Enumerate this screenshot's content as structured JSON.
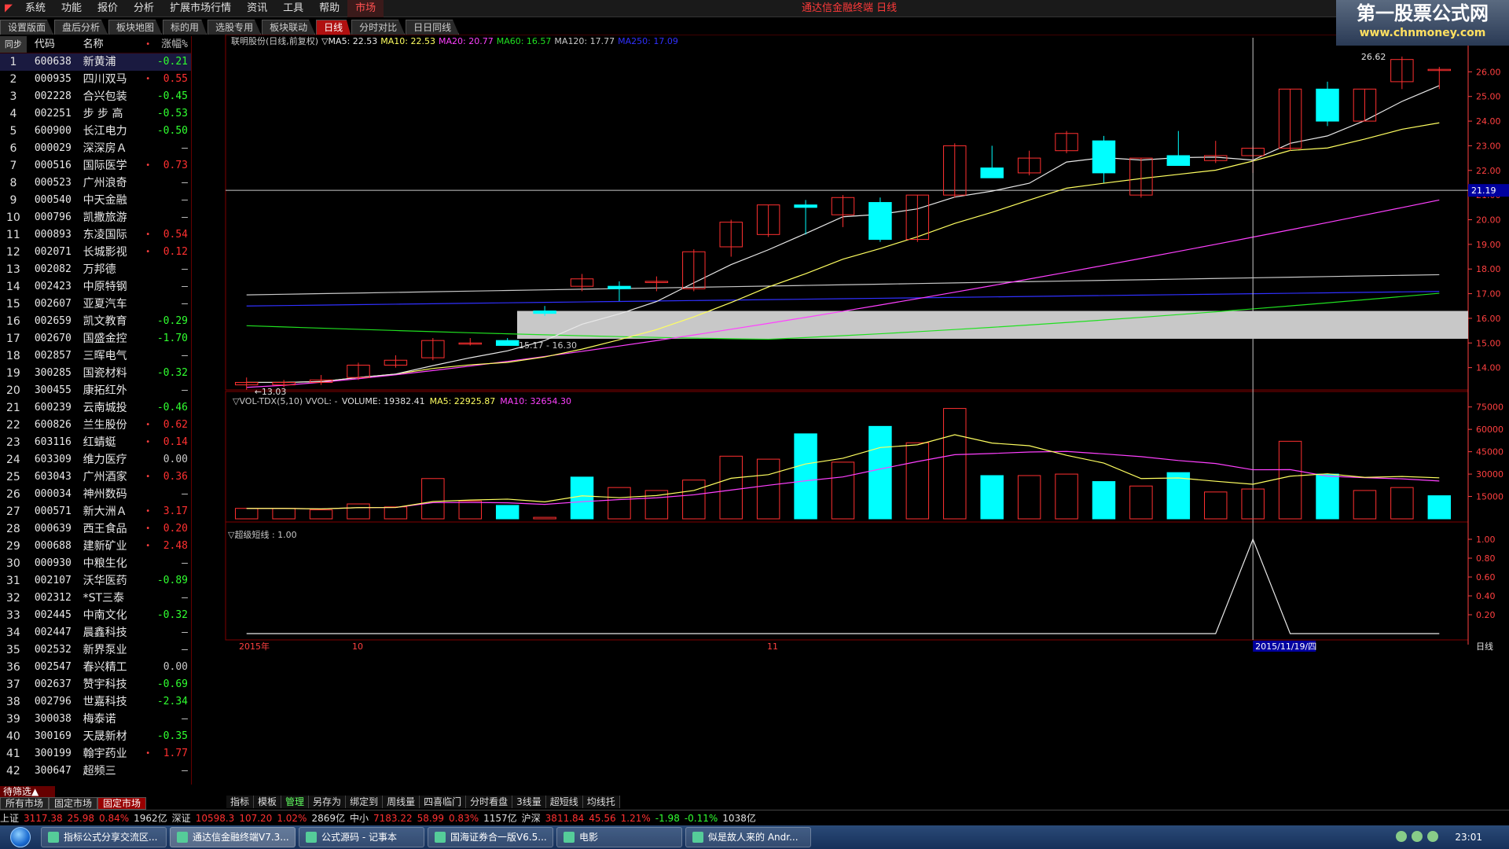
{
  "menubar": {
    "items": [
      "系统",
      "功能",
      "报价",
      "分析",
      "扩展市场行情",
      "资讯",
      "工具",
      "帮助",
      "市场"
    ],
    "title": "通达信金融终端 日线",
    "brand_main": "第一股票公式网",
    "brand_url": "www.chnmoney.com"
  },
  "tabs": [
    "设置版面",
    "盘后分析",
    "板块地图",
    "标的用",
    "选股专用",
    "板块联动",
    "日线",
    "分时对比",
    "日日同线"
  ],
  "active_tab": 6,
  "list": {
    "head": {
      "sync": "同步",
      "code": "代码",
      "name": "名称",
      "dot": "•",
      "chg": "涨幅%"
    },
    "rows": [
      {
        "i": "1",
        "code": "600638",
        "name": "新黄浦",
        "mark": "",
        "chg": "-0.21",
        "dir": "down"
      },
      {
        "i": "2",
        "code": "000935",
        "name": "四川双马",
        "mark": "•",
        "chg": "0.55",
        "dir": "up"
      },
      {
        "i": "3",
        "code": "002228",
        "name": "合兴包装",
        "mark": "",
        "chg": "-0.45",
        "dir": "down"
      },
      {
        "i": "4",
        "code": "002251",
        "name": "步 步 高",
        "mark": "",
        "chg": "-0.53",
        "dir": "down"
      },
      {
        "i": "5",
        "code": "600900",
        "name": "长江电力",
        "mark": "",
        "chg": "-0.50",
        "dir": "down"
      },
      {
        "i": "6",
        "code": "000029",
        "name": "深深房Ａ",
        "mark": "",
        "chg": "–",
        "dir": "flat"
      },
      {
        "i": "7",
        "code": "000516",
        "name": "国际医学",
        "mark": "•",
        "chg": "0.73",
        "dir": "up"
      },
      {
        "i": "8",
        "code": "000523",
        "name": "广州浪奇",
        "mark": "",
        "chg": "–",
        "dir": "flat"
      },
      {
        "i": "9",
        "code": "000540",
        "name": "中天金融",
        "mark": "",
        "chg": "–",
        "dir": "flat"
      },
      {
        "i": "10",
        "code": "000796",
        "name": "凯撒旅游",
        "mark": "",
        "chg": "–",
        "dir": "flat"
      },
      {
        "i": "11",
        "code": "000893",
        "name": "东凌国际",
        "mark": "•",
        "chg": "0.54",
        "dir": "up"
      },
      {
        "i": "12",
        "code": "002071",
        "name": "长城影视",
        "mark": "•",
        "chg": "0.12",
        "dir": "up"
      },
      {
        "i": "13",
        "code": "002082",
        "name": "万邦德",
        "mark": "",
        "chg": "–",
        "dir": "flat"
      },
      {
        "i": "14",
        "code": "002423",
        "name": "中原特钢",
        "mark": "",
        "chg": "–",
        "dir": "flat"
      },
      {
        "i": "15",
        "code": "002607",
        "name": "亚夏汽车",
        "mark": "",
        "chg": "–",
        "dir": "flat"
      },
      {
        "i": "16",
        "code": "002659",
        "name": "凯文教育",
        "mark": "",
        "chg": "-0.29",
        "dir": "down"
      },
      {
        "i": "17",
        "code": "002670",
        "name": "国盛金控",
        "mark": "",
        "chg": "-1.70",
        "dir": "down"
      },
      {
        "i": "18",
        "code": "002857",
        "name": "三晖电气",
        "mark": "",
        "chg": "–",
        "dir": "flat"
      },
      {
        "i": "19",
        "code": "300285",
        "name": "国瓷材料",
        "mark": "",
        "chg": "-0.32",
        "dir": "down"
      },
      {
        "i": "20",
        "code": "300455",
        "name": "康拓红外",
        "mark": "",
        "chg": "–",
        "dir": "flat"
      },
      {
        "i": "21",
        "code": "600239",
        "name": "云南城投",
        "mark": "",
        "chg": "-0.46",
        "dir": "down"
      },
      {
        "i": "22",
        "code": "600826",
        "name": "兰生股份",
        "mark": "•",
        "chg": "0.62",
        "dir": "up"
      },
      {
        "i": "23",
        "code": "603116",
        "name": "红蜻蜓",
        "mark": "•",
        "chg": "0.14",
        "dir": "up"
      },
      {
        "i": "24",
        "code": "603309",
        "name": "维力医疗",
        "mark": "",
        "chg": "0.00",
        "dir": "flat"
      },
      {
        "i": "25",
        "code": "603043",
        "name": "广州酒家",
        "mark": "•",
        "chg": "0.36",
        "dir": "up"
      },
      {
        "i": "26",
        "code": "000034",
        "name": "神州数码",
        "mark": "",
        "chg": "–",
        "dir": "flat"
      },
      {
        "i": "27",
        "code": "000571",
        "name": "新大洲Ａ",
        "mark": "•",
        "chg": "3.17",
        "dir": "up"
      },
      {
        "i": "28",
        "code": "000639",
        "name": "西王食品",
        "mark": "•",
        "chg": "0.20",
        "dir": "up"
      },
      {
        "i": "29",
        "code": "000688",
        "name": "建新矿业",
        "mark": "•",
        "chg": "2.48",
        "dir": "up"
      },
      {
        "i": "30",
        "code": "000930",
        "name": "中粮生化",
        "mark": "",
        "chg": "–",
        "dir": "flat"
      },
      {
        "i": "31",
        "code": "002107",
        "name": "沃华医药",
        "mark": "",
        "chg": "-0.89",
        "dir": "down"
      },
      {
        "i": "32",
        "code": "002312",
        "name": "*ST三泰",
        "mark": "",
        "chg": "–",
        "dir": "flat"
      },
      {
        "i": "33",
        "code": "002445",
        "name": "中南文化",
        "mark": "",
        "chg": "-0.32",
        "dir": "down"
      },
      {
        "i": "34",
        "code": "002447",
        "name": "晨鑫科技",
        "mark": "",
        "chg": "–",
        "dir": "flat"
      },
      {
        "i": "35",
        "code": "002532",
        "name": "新界泵业",
        "mark": "",
        "chg": "–",
        "dir": "flat"
      },
      {
        "i": "36",
        "code": "002547",
        "name": "春兴精工",
        "mark": "",
        "chg": "0.00",
        "dir": "flat"
      },
      {
        "i": "37",
        "code": "002637",
        "name": "赞宇科技",
        "mark": "",
        "chg": "-0.69",
        "dir": "down"
      },
      {
        "i": "38",
        "code": "002796",
        "name": "世嘉科技",
        "mark": "",
        "chg": "-2.34",
        "dir": "down"
      },
      {
        "i": "39",
        "code": "300038",
        "name": "梅泰诺",
        "mark": "",
        "chg": "–",
        "dir": "flat"
      },
      {
        "i": "40",
        "code": "300169",
        "name": "天晟新材",
        "mark": "",
        "chg": "-0.35",
        "dir": "down"
      },
      {
        "i": "41",
        "code": "300199",
        "name": "翰宇药业",
        "mark": "•",
        "chg": "1.77",
        "dir": "up"
      },
      {
        "i": "42",
        "code": "300647",
        "name": "超频三",
        "mark": "",
        "chg": "–",
        "dir": "flat"
      }
    ]
  },
  "list_tabs": {
    "filter": "待筛选▲",
    "tabs": [
      "所有市场",
      "固定市场",
      "固定市场"
    ],
    "active": 2
  },
  "indicator_tabs": [
    "指标",
    "模板",
    "管理",
    "另存为",
    "绑定到",
    "周线量",
    "四喜临门",
    "分时看盘",
    "3线量",
    "超短线",
    "均线托"
  ],
  "indicator_active": 2,
  "colors": {
    "up": "#ff3030",
    "down": "#30ff30",
    "bear_fill": "#00ffff",
    "ma5": "#e8e8e8",
    "ma10": "#ffff60",
    "ma20": "#ff40ff",
    "ma60": "#20e020",
    "ma120": "#c8c8c8",
    "ma250": "#3030ff",
    "grid": "#800000",
    "axis": "#ff4040"
  },
  "panels": {
    "price_header": "联明股份(日线,前复权)",
    "ma5": "▽MA5: 22.53",
    "ma10": "MA10: 22.53",
    "ma20": "MA20: 20.77",
    "ma60": "MA60: 16.57",
    "ma120": "MA120: 17.77",
    "ma250": "MA250: 17.09",
    "vol_header": "▽VOL-TDX(5,10) VVOL: -",
    "vol_value": "VOLUME: 19382.41",
    "vol_ma5": "MA5: 22925.87",
    "vol_ma10": "MA10: 32654.30",
    "ind_header": "▽超级短线 : 1.00",
    "high_label": "26.62",
    "low_label": "13.03",
    "zone_label": "15.17 - 16.30",
    "crosshair_price": "21.19",
    "date_year": "2015年",
    "date_10": "10",
    "date_11": "11",
    "date_cursor": "2015/11/19/四",
    "period": "日线"
  },
  "chart_data": [
    {
      "type": "candlestick",
      "title": "联明股份(日线,前复权)",
      "yticks": [
        "26.00",
        "25.00",
        "24.00",
        "23.00",
        "22.00",
        "21.00",
        "20.00",
        "19.00",
        "18.00",
        "17.00",
        "16.00",
        "15.00",
        "14.00"
      ],
      "ylim": [
        13.0,
        27.0
      ],
      "candles": [
        [
          13.3,
          13.6,
          13.1,
          13.4
        ],
        [
          13.3,
          13.5,
          13.2,
          13.4
        ],
        [
          13.4,
          13.7,
          13.3,
          13.5
        ],
        [
          13.6,
          14.2,
          13.5,
          14.1
        ],
        [
          14.1,
          14.5,
          14.0,
          14.3
        ],
        [
          14.4,
          15.2,
          14.3,
          15.1
        ],
        [
          15.0,
          15.2,
          14.9,
          15.0
        ],
        [
          15.1,
          15.2,
          14.9,
          14.9
        ],
        [
          16.3,
          16.5,
          16.1,
          16.2
        ],
        [
          17.3,
          17.8,
          17.1,
          17.6
        ],
        [
          17.3,
          17.5,
          16.7,
          17.2
        ],
        [
          17.5,
          17.7,
          17.1,
          17.5
        ],
        [
          17.2,
          18.8,
          17.1,
          18.7
        ],
        [
          18.9,
          20.0,
          18.5,
          19.9
        ],
        [
          19.4,
          20.6,
          19.3,
          20.6
        ],
        [
          20.6,
          20.8,
          19.4,
          20.5
        ],
        [
          20.2,
          21.0,
          19.7,
          20.9
        ],
        [
          20.7,
          20.9,
          19.1,
          19.2
        ],
        [
          19.2,
          21.0,
          19.1,
          21.0
        ],
        [
          21.0,
          23.1,
          20.9,
          23.0
        ],
        [
          22.1,
          23.0,
          21.8,
          21.7
        ],
        [
          21.9,
          22.8,
          21.8,
          22.5
        ],
        [
          22.8,
          23.6,
          22.7,
          23.5
        ],
        [
          23.2,
          23.4,
          21.5,
          21.9
        ],
        [
          21.0,
          22.5,
          20.9,
          22.5
        ],
        [
          22.6,
          23.6,
          22.3,
          22.2
        ],
        [
          22.4,
          23.2,
          22.3,
          22.6
        ],
        [
          22.6,
          23.0,
          21.9,
          22.9
        ],
        [
          22.9,
          25.3,
          22.8,
          25.3
        ],
        [
          25.3,
          25.6,
          23.8,
          24.0
        ],
        [
          24.0,
          25.3,
          24.0,
          25.3
        ],
        [
          25.6,
          26.62,
          25.3,
          26.5
        ],
        [
          26.1,
          26.2,
          25.3,
          26.1
        ]
      ],
      "ma_lines": {
        "MA5": 22.53,
        "MA10": 22.53,
        "MA20": 20.77,
        "MA60": 16.57,
        "MA120": 17.77,
        "MA250": 17.09
      },
      "annotations": {
        "high": 26.62,
        "low": 13.03,
        "zone": [
          15.17,
          16.3
        ],
        "crosshair": 21.19
      }
    },
    {
      "type": "bar",
      "title": "VOL-TDX(5,10)",
      "yticks": [
        "75000",
        "60000",
        "45000",
        "30000",
        "15000"
      ],
      "ylim": [
        0,
        78000
      ],
      "values": [
        7000,
        7000,
        6000,
        10000,
        8000,
        27000,
        12000,
        9000,
        1000,
        28000,
        21000,
        19000,
        26000,
        42000,
        40000,
        57000,
        38000,
        62000,
        51000,
        74000,
        29000,
        29000,
        30000,
        25000,
        22000,
        31000,
        18000,
        20000,
        52000,
        30000,
        19000,
        21000,
        15500
      ],
      "bear": [
        false,
        false,
        false,
        false,
        false,
        false,
        false,
        true,
        false,
        true,
        false,
        false,
        false,
        false,
        false,
        true,
        false,
        true,
        false,
        false,
        true,
        false,
        false,
        true,
        false,
        true,
        false,
        false,
        false,
        true,
        false,
        false,
        true
      ],
      "VOLUME": 19382.41,
      "MA5": 22925.87,
      "MA10": 32654.3
    },
    {
      "type": "line",
      "title": "超级短线",
      "yticks": [
        "1.00",
        "0.80",
        "0.60",
        "0.40",
        "0.20"
      ],
      "ylim": [
        0,
        1.1
      ],
      "values": [
        0,
        0,
        0,
        0,
        0,
        0,
        0,
        0,
        0,
        0,
        0,
        0,
        0,
        0,
        0,
        0,
        0,
        0,
        0,
        0,
        0,
        0,
        0,
        0,
        0,
        0,
        0,
        1.0,
        0,
        0,
        0,
        0,
        0
      ]
    }
  ],
  "statusbar": [
    {
      "t": "上证",
      "c": "#e0e0e0"
    },
    {
      "t": "3117.38",
      "c": "#ff3030"
    },
    {
      "t": "25.98",
      "c": "#ff3030"
    },
    {
      "t": "0.84%",
      "c": "#ff3030"
    },
    {
      "t": "1962亿",
      "c": "#e0e0e0"
    },
    {
      "t": "深证",
      "c": "#e0e0e0"
    },
    {
      "t": "10598.3",
      "c": "#ff3030"
    },
    {
      "t": "107.20",
      "c": "#ff3030"
    },
    {
      "t": "1.02%",
      "c": "#ff3030"
    },
    {
      "t": "2869亿",
      "c": "#e0e0e0"
    },
    {
      "t": "中小",
      "c": "#e0e0e0"
    },
    {
      "t": "7183.22",
      "c": "#ff3030"
    },
    {
      "t": "58.99",
      "c": "#ff3030"
    },
    {
      "t": "0.83%",
      "c": "#ff3030"
    },
    {
      "t": "1157亿",
      "c": "#e0e0e0"
    },
    {
      "t": "沪深",
      "c": "#e0e0e0"
    },
    {
      "t": "3811.84",
      "c": "#ff3030"
    },
    {
      "t": "45.56",
      "c": "#ff3030"
    },
    {
      "t": "1.21%",
      "c": "#ff3030"
    },
    {
      "t": "-1.98",
      "c": "#30ff30"
    },
    {
      "t": "-0.11%",
      "c": "#30ff30"
    },
    {
      "t": "1038亿",
      "c": "#e0e0e0"
    }
  ],
  "taskbar": {
    "tasks": [
      "指标公式分享交流区...",
      "通达信金融终端V7.3...",
      "公式源码 - 记事本",
      "国海证券合一版V6.5...",
      "电影",
      "似是故人来的 Andr..."
    ],
    "active": 1,
    "clock": "23:01"
  }
}
